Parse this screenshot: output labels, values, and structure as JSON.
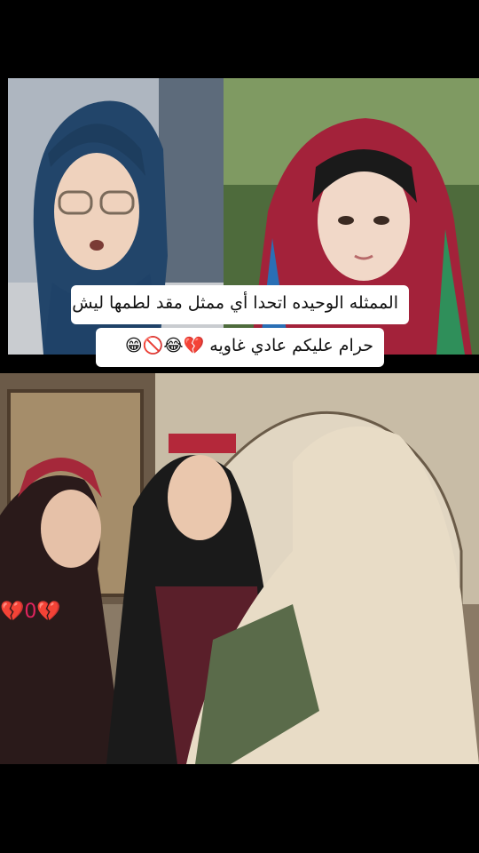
{
  "caption": {
    "line1": "الممثله الوحيده اتحدا أي ممثل مقد لطمها ليش",
    "line2": "حرام عليكم عادي غاويه 💔😂🚫😁"
  },
  "overlay": {
    "emoji": "💔0💔"
  },
  "colors": {
    "background": "#000000",
    "caption_bg": "#ffffff",
    "caption_text": "#111111"
  }
}
